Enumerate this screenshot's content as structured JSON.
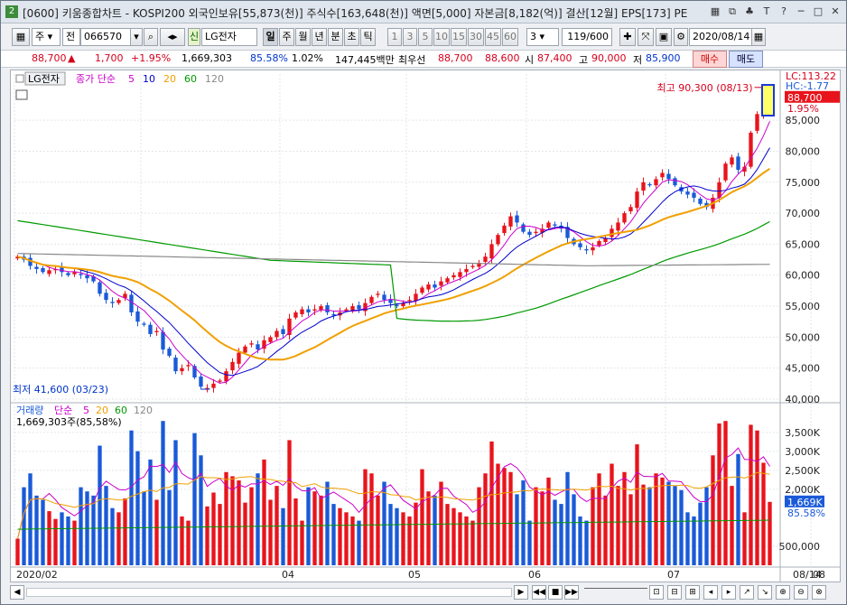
{
  "window": {
    "num": "2",
    "title": "[0600] 키움종합차트 - KOSPI200 외국인보유[55,873(천)] 주식수[163,648(천)] 액면[5,000] 자본금[8,182(억)] 결산[12월] EPS[173] PE",
    "buttons": [
      "▦",
      "⧉",
      "♣",
      "T",
      "?",
      "─",
      "□",
      "✕"
    ]
  },
  "toolbar": {
    "sel1": "주",
    "sel2": "전",
    "code": "066570",
    "badge": "신",
    "name": "LG전자",
    "periods": [
      "일",
      "주",
      "월",
      "년",
      "분",
      "초",
      "틱"
    ],
    "nums": [
      "1",
      "3",
      "5",
      "10",
      "15",
      "30",
      "45",
      "60"
    ],
    "stepper": "3",
    "count": "119/600",
    "date": "2020/08/14"
  },
  "info": {
    "price": "88,700",
    "arrow": "▲",
    "change": "1,700",
    "rate": "+1.95%",
    "volume": "1,669,303",
    "vol_rate": "85.58%",
    "pct": "1.02%",
    "amount": "147,445백만",
    "label_best": "최우선",
    "ask": "88,700",
    "bid": "88,600",
    "lbl_open": "시",
    "open": "87,400",
    "lbl_high": "고",
    "high": "90,000",
    "lbl_low": "저",
    "low": "85,900",
    "buy": "매수",
    "sell": "매도"
  },
  "price_panel": {
    "name": "LG전자",
    "legend_prefix": "종가 단순",
    "ma_labels": [
      "5",
      "10",
      "20",
      "60",
      "120"
    ],
    "ma_colors": [
      "#cc00cc",
      "#0000cc",
      "#f0a000",
      "#009900",
      "#888888"
    ],
    "high_label": "최고 90,300 (08/13)",
    "low_label": "최저 41,600 (03/23)",
    "lc": "LC:113.22",
    "hc": "HC:-1.77",
    "cur_price": "88,700",
    "cur_rate": "1.95%",
    "yticks": [
      "85,000",
      "80,000",
      "75,000",
      "70,000",
      "65,000",
      "60,000",
      "55,000",
      "50,000",
      "45,000",
      "40,000"
    ]
  },
  "volume_panel": {
    "legend_title": "거래량",
    "legend_prefix": "단순",
    "ma_labels": [
      "5",
      "20",
      "60",
      "120"
    ],
    "ma_colors": [
      "#cc00cc",
      "#f0a000",
      "#009900",
      "#888888"
    ],
    "sub": "1,669,303주(85,58%)",
    "yticks": [
      "3,500K",
      "3,000K",
      "2,500K",
      "2,000K",
      "500,000"
    ],
    "cur": "1,669K",
    "cur_rate": "85.58%"
  },
  "xaxis": {
    "labels": [
      "2020/02",
      "04",
      "05",
      "06",
      "07",
      "08"
    ],
    "right": "08/14"
  },
  "chart_data": {
    "type": "candlestick",
    "ylim": [
      40000,
      91000
    ],
    "volume_ylim": [
      0,
      3900000
    ],
    "x": [
      "2020-02-03",
      "2020-02-04",
      "2020-02-05",
      "2020-02-06",
      "2020-02-07",
      "2020-02-10",
      "2020-02-11",
      "2020-02-12",
      "2020-02-13",
      "2020-02-14",
      "2020-02-17",
      "2020-02-18",
      "2020-02-19",
      "2020-02-20",
      "2020-02-21",
      "2020-02-24",
      "2020-02-25",
      "2020-02-26",
      "2020-02-27",
      "2020-02-28",
      "2020-03-02",
      "2020-03-03",
      "2020-03-04",
      "2020-03-05",
      "2020-03-06",
      "2020-03-09",
      "2020-03-10",
      "2020-03-11",
      "2020-03-12",
      "2020-03-13",
      "2020-03-16",
      "2020-03-17",
      "2020-03-18",
      "2020-03-19",
      "2020-03-20",
      "2020-03-23",
      "2020-03-24",
      "2020-03-25",
      "2020-03-26",
      "2020-03-27",
      "2020-03-30",
      "2020-03-31",
      "2020-04-01",
      "2020-04-02",
      "2020-04-03",
      "2020-04-06",
      "2020-04-07",
      "2020-04-08",
      "2020-04-09",
      "2020-04-10",
      "2020-04-13",
      "2020-04-14",
      "2020-04-16",
      "2020-04-17",
      "2020-04-20",
      "2020-04-21",
      "2020-04-22",
      "2020-04-23",
      "2020-04-24",
      "2020-04-27",
      "2020-04-28",
      "2020-04-29",
      "2020-05-04",
      "2020-05-06",
      "2020-05-07",
      "2020-05-08",
      "2020-05-11",
      "2020-05-12",
      "2020-05-13",
      "2020-05-14",
      "2020-05-15",
      "2020-05-18",
      "2020-05-19",
      "2020-05-20",
      "2020-05-21",
      "2020-05-22",
      "2020-05-25",
      "2020-05-26",
      "2020-05-27",
      "2020-05-28",
      "2020-05-29",
      "2020-06-01",
      "2020-06-02",
      "2020-06-03",
      "2020-06-04",
      "2020-06-05",
      "2020-06-08",
      "2020-06-09",
      "2020-06-10",
      "2020-06-11",
      "2020-06-12",
      "2020-06-15",
      "2020-06-16",
      "2020-06-17",
      "2020-06-18",
      "2020-06-19",
      "2020-06-22",
      "2020-06-23",
      "2020-06-24",
      "2020-06-25",
      "2020-06-26",
      "2020-06-29",
      "2020-06-30",
      "2020-07-01",
      "2020-07-02",
      "2020-07-03",
      "2020-07-06",
      "2020-07-07",
      "2020-07-08",
      "2020-07-09",
      "2020-07-10",
      "2020-07-13",
      "2020-07-14",
      "2020-07-15",
      "2020-07-16",
      "2020-07-17",
      "2020-07-20",
      "2020-07-21",
      "2020-07-22",
      "2020-07-23",
      "2020-07-24",
      "2020-07-27",
      "2020-07-28",
      "2020-07-29",
      "2020-07-30",
      "2020-07-31",
      "2020-08-03",
      "2020-08-04",
      "2020-08-05",
      "2020-08-06",
      "2020-08-07",
      "2020-08-10",
      "2020-08-11",
      "2020-08-12",
      "2020-08-13",
      "2020-08-14"
    ],
    "series": [
      {
        "name": "종가",
        "values": [
          63000,
          62500,
          61500,
          61000,
          60500,
          60800,
          61000,
          60500,
          60000,
          60500,
          60000,
          59500,
          59000,
          57000,
          56000,
          55500,
          56000,
          57000,
          54000,
          52500,
          52000,
          50500,
          51000,
          48000,
          47000,
          44500,
          45000,
          45500,
          43500,
          42000,
          41800,
          42500,
          43000,
          44500,
          46000,
          47500,
          48500,
          49000,
          48000,
          49500,
          50000,
          51000,
          50500,
          53000,
          54000,
          54500,
          54000,
          54500,
          55000,
          54000,
          53500,
          54000,
          54500,
          55000,
          54500,
          55500,
          56500,
          57000,
          56000,
          55500,
          55000,
          55500,
          56000,
          57000,
          58000,
          58500,
          58000,
          59000,
          59500,
          60000,
          60500,
          61000,
          61500,
          62000,
          63000,
          65000,
          66500,
          68000,
          69500,
          68500,
          67000,
          66500,
          67000,
          67500,
          68500,
          68000,
          67500,
          66000,
          65000,
          64500,
          64000,
          64500,
          65500,
          66000,
          67500,
          68500,
          70000,
          71000,
          73500,
          75000,
          74500,
          75500,
          76500,
          75500,
          74500,
          73500,
          73000,
          72500,
          71500,
          71000,
          72500,
          75000,
          78000,
          79000,
          77000,
          77500,
          83000,
          86000,
          89000,
          88700
        ]
      }
    ],
    "ma_names": [
      "5",
      "10",
      "20",
      "60",
      "120"
    ],
    "high": {
      "date": "2020-08-13",
      "value": 90300
    },
    "low": {
      "date": "2020-03-23",
      "value": 41600
    }
  }
}
